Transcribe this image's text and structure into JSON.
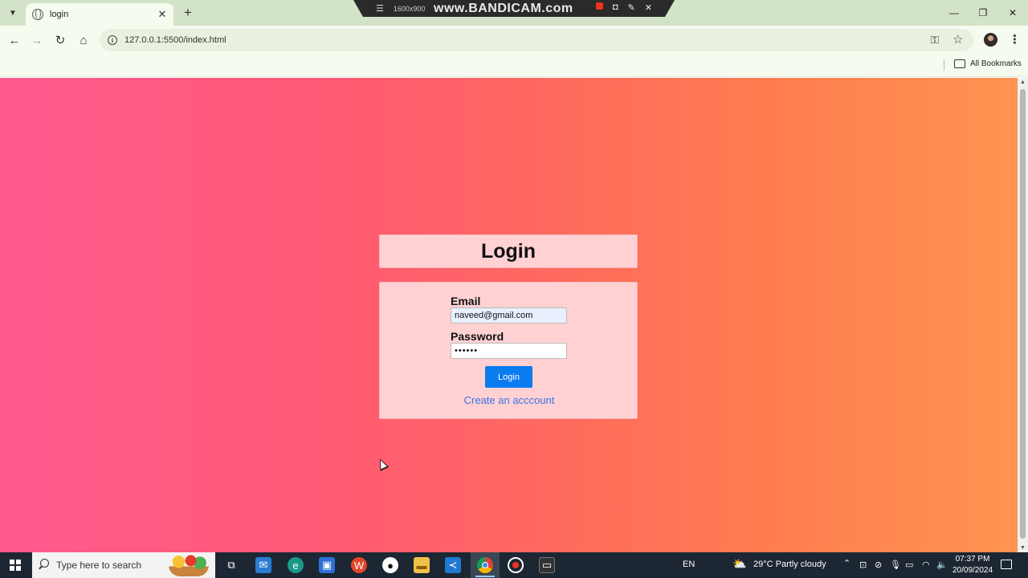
{
  "browser": {
    "tab_title": "login",
    "url": "127.0.0.1:5500/index.html",
    "bookmarks_label": "All Bookmarks"
  },
  "recorder": {
    "resolution": "1600x900",
    "brand": "www.BANDICAM.com"
  },
  "page": {
    "heading": "Login",
    "email_label": "Email",
    "email_value": "naveed@gmail.com",
    "password_label": "Password",
    "password_value": "••••••",
    "login_button": "Login",
    "create_link": "Create an acccount"
  },
  "taskbar": {
    "search_placeholder": "Type here to search",
    "language": "EN",
    "weather": "29°C  Partly cloudy",
    "time": "07:37 PM",
    "date": "20/09/2024"
  },
  "colors": {
    "accent_button": "#0a7cf0",
    "link": "#3a73e8",
    "panel": "#ffd1d3"
  }
}
